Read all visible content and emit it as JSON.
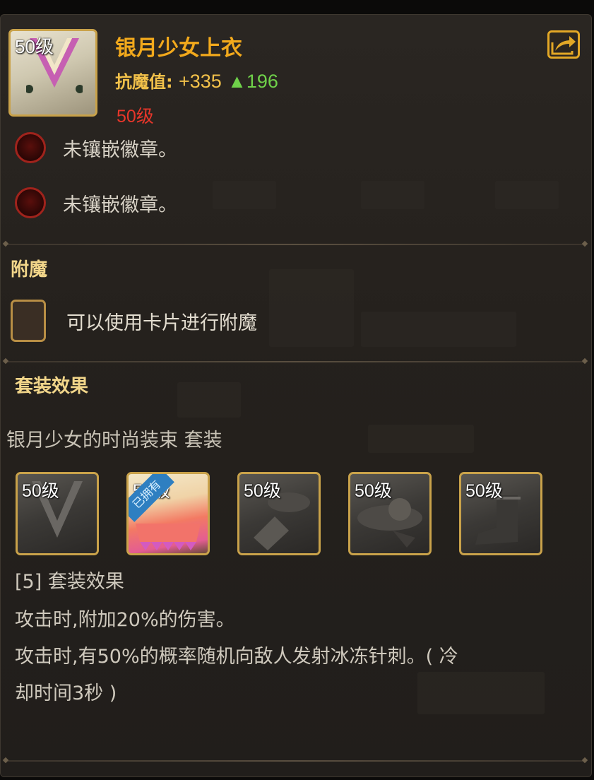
{
  "item": {
    "level_badge": "50级",
    "name": "银月少女上衣",
    "stat_label": "抗魔值:",
    "stat_value": "+335",
    "stat_delta": "▲196",
    "required_level": "50级"
  },
  "sockets": [
    {
      "text": "未镶嵌徽章。"
    },
    {
      "text": "未镶嵌徽章。"
    }
  ],
  "enchant": {
    "title": "附魔",
    "text": "可以使用卡片进行附魔"
  },
  "set": {
    "title": "套装效果",
    "name": "银月少女的时尚装束 套装",
    "items": [
      {
        "level": "50级",
        "equipped": false
      },
      {
        "level": "50级",
        "equipped": true,
        "tag": "已拥有"
      },
      {
        "level": "50级",
        "equipped": false
      },
      {
        "level": "50级",
        "equipped": false
      },
      {
        "level": "50级",
        "equipped": false
      }
    ],
    "bonus_header": "[5] 套装效果",
    "bonus_lines": [
      "攻击时,附加20%的伤害。",
      "攻击时,有50%的概率随机向敌人发射冰冻针刺。( 冷",
      "却时间3秒 )"
    ]
  },
  "colors": {
    "title": "#f2a91c",
    "frame_gold": "#c9a24a",
    "stat_up": "#6fd14a",
    "required_level": "#e8362a"
  }
}
